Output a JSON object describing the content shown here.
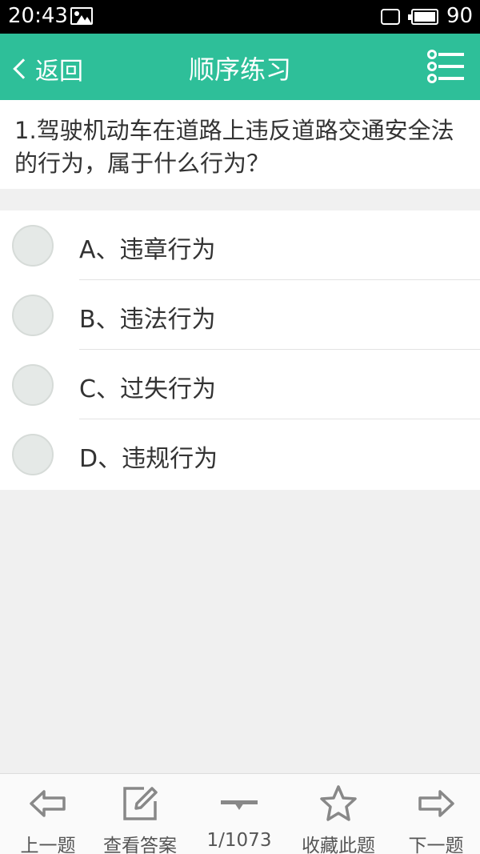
{
  "status_bar": {
    "time": "20:43",
    "battery": "90"
  },
  "header": {
    "back_label": "返回",
    "title": "顺序练习"
  },
  "question": {
    "text": "1.驾驶机动车在道路上违反道路交通安全法的行为，属于什么行为？"
  },
  "options": [
    {
      "label": "A、违章行为"
    },
    {
      "label": "B、违法行为"
    },
    {
      "label": "C、过失行为"
    },
    {
      "label": "D、违规行为"
    }
  ],
  "toolbar": {
    "prev": "上一题",
    "answer": "查看答案",
    "progress": "1/1073",
    "favorite": "收藏此题",
    "next": "下一题"
  },
  "colors": {
    "primary": "#2ebf99",
    "icon_gray": "#888888"
  }
}
